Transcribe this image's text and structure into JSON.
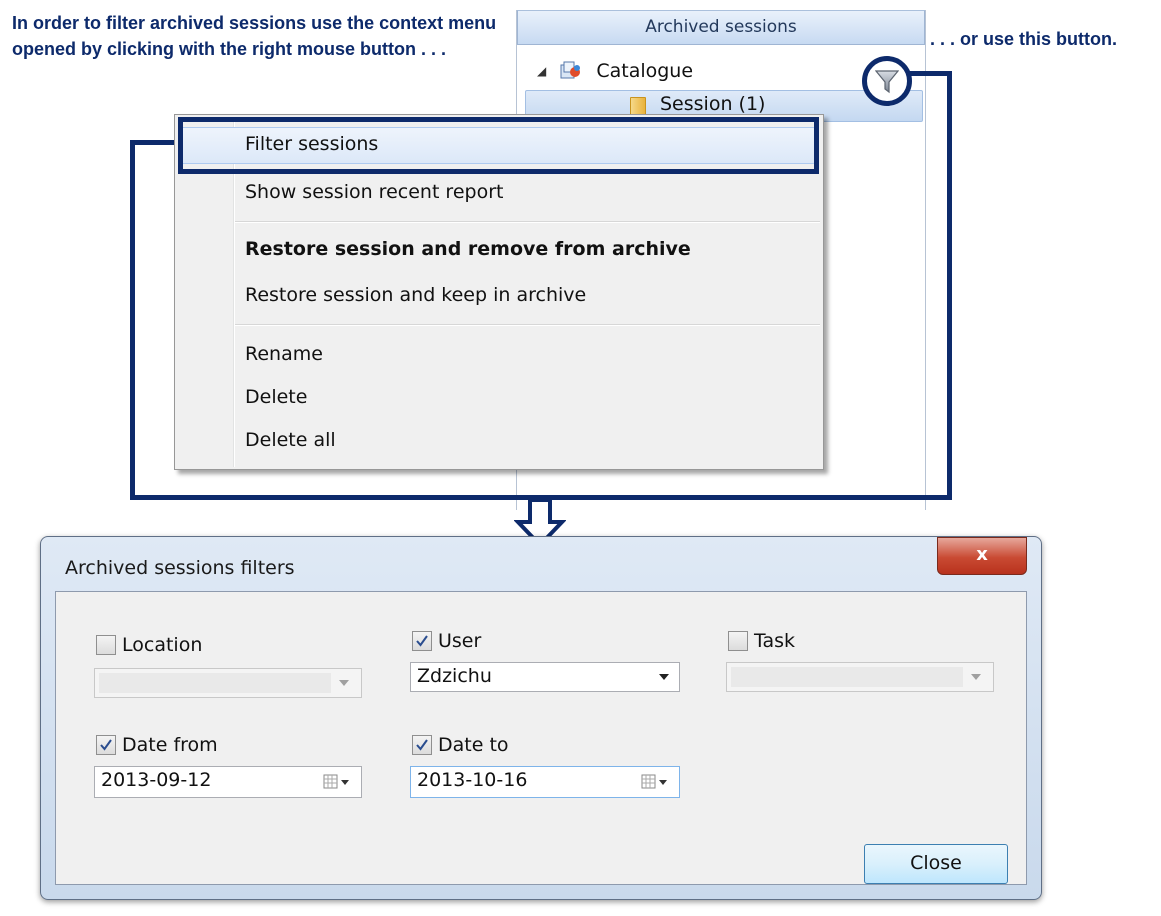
{
  "annotations": {
    "left": "In order to filter archived sessions use the context menu opened by clicking with the right mouse button . . .",
    "right": ". . . or use this button."
  },
  "panel": {
    "header": "Archived sessions",
    "tree": {
      "root_label": "Catalogue",
      "child_label": "Session (1)"
    }
  },
  "context_menu": {
    "items": [
      "Filter sessions",
      "Show session recent report",
      "Restore session and remove from archive",
      "Restore session and keep in archive",
      "Rename",
      "Delete",
      "Delete all"
    ]
  },
  "dialog": {
    "title": "Archived sessions filters",
    "close_glyph": "x",
    "location": {
      "label": "Location",
      "checked": false,
      "value": ""
    },
    "user": {
      "label": "User",
      "checked": true,
      "value": "Zdzichu"
    },
    "task": {
      "label": "Task",
      "checked": false,
      "value": ""
    },
    "date_from": {
      "label": "Date from",
      "checked": true,
      "value": "2013-09-12"
    },
    "date_to": {
      "label": "Date to",
      "checked": true,
      "value": "2013-10-16"
    },
    "close_button": "Close"
  },
  "colors": {
    "annotation": "#0d2a6b",
    "highlight_frame": "#0d2a6b"
  }
}
